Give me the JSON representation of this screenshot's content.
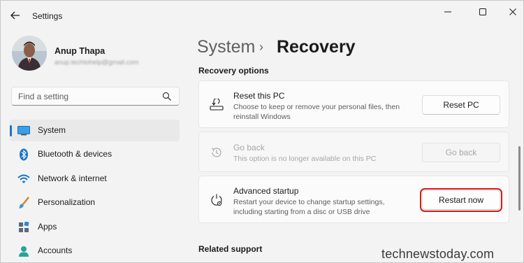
{
  "titlebar": {
    "app_title": "Settings",
    "back_icon": "back-arrow-icon",
    "controls": [
      "minimize-icon",
      "maximize-icon",
      "close-icon"
    ]
  },
  "profile": {
    "name": "Anup Thapa",
    "email": "anup.techtohelp@gmail.com"
  },
  "search": {
    "placeholder": "Find a setting",
    "icon": "search-icon"
  },
  "sidebar": {
    "items": [
      {
        "label": "System",
        "icon": "system-icon",
        "selected": true
      },
      {
        "label": "Bluetooth & devices",
        "icon": "bluetooth-icon",
        "selected": false
      },
      {
        "label": "Network & internet",
        "icon": "wifi-icon",
        "selected": false
      },
      {
        "label": "Personalization",
        "icon": "paintbrush-icon",
        "selected": false
      },
      {
        "label": "Apps",
        "icon": "apps-icon",
        "selected": false
      },
      {
        "label": "Accounts",
        "icon": "account-icon",
        "selected": false
      }
    ]
  },
  "main": {
    "breadcrumb_parent": "System",
    "breadcrumb_sep": "›",
    "breadcrumb_current": "Recovery",
    "section_recovery": "Recovery options",
    "section_support": "Related support",
    "cards": [
      {
        "title": "Reset this PC",
        "desc": "Choose to keep or remove your personal files, then reinstall Windows",
        "button": "Reset PC",
        "icon": "reset-pc-icon",
        "disabled": false
      },
      {
        "title": "Go back",
        "desc": "This option is no longer available on this PC",
        "button": "Go back",
        "icon": "history-icon",
        "disabled": true
      },
      {
        "title": "Advanced startup",
        "desc": "Restart your device to change startup settings, including starting from a disc or USB drive",
        "button": "Restart now",
        "icon": "advanced-startup-icon",
        "disabled": false
      }
    ]
  },
  "watermark": "technewstoday.com",
  "colors": {
    "accent": "#1a73c8",
    "highlight": "#d11a1a",
    "background": "#f3f3f3"
  }
}
